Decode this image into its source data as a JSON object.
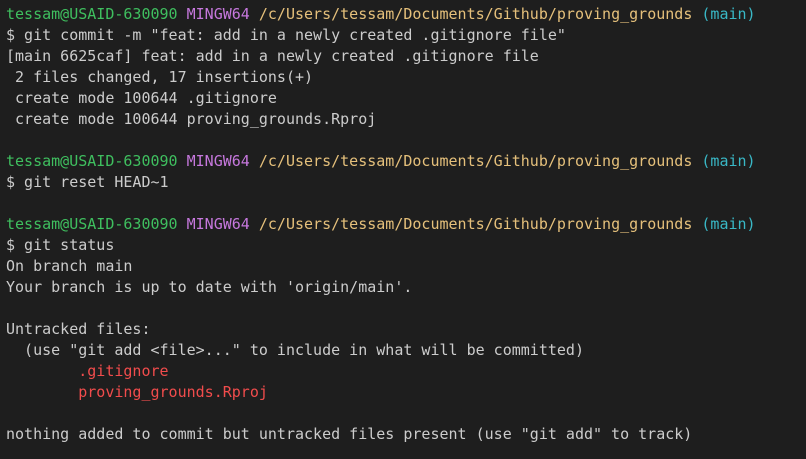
{
  "prompt": {
    "user_host": "tessam@USAID-630090",
    "system": "MINGW64",
    "path": "/c/Users/tessam/Documents/Github/proving_grounds",
    "branch": "(main)"
  },
  "colors": {
    "background": "#1e1e1e",
    "text": "#cccccc",
    "user_host": "#3fbf5f",
    "system": "#c678dd",
    "path": "#e5c07b",
    "branch": "#39b8c6",
    "untracked": "#f14c4c"
  },
  "lines": [
    {
      "type": "prompt"
    },
    {
      "type": "text",
      "text": "$ git commit -m \"feat: add in a newly created .gitignore file\""
    },
    {
      "type": "text",
      "text": "[main 6625caf] feat: add in a newly created .gitignore file"
    },
    {
      "type": "text",
      "text": " 2 files changed, 17 insertions(+)"
    },
    {
      "type": "text",
      "text": " create mode 100644 .gitignore"
    },
    {
      "type": "text",
      "text": " create mode 100644 proving_grounds.Rproj"
    },
    {
      "type": "blank"
    },
    {
      "type": "prompt"
    },
    {
      "type": "text",
      "text": "$ git reset HEAD~1"
    },
    {
      "type": "blank"
    },
    {
      "type": "prompt"
    },
    {
      "type": "text",
      "text": "$ git status"
    },
    {
      "type": "text",
      "text": "On branch main"
    },
    {
      "type": "text",
      "text": "Your branch is up to date with 'origin/main'."
    },
    {
      "type": "blank"
    },
    {
      "type": "text",
      "text": "Untracked files:"
    },
    {
      "type": "text",
      "text": "  (use \"git add <file>...\" to include in what will be committed)"
    },
    {
      "type": "untracked",
      "text": "        .gitignore"
    },
    {
      "type": "untracked",
      "text": "        proving_grounds.Rproj"
    },
    {
      "type": "blank"
    },
    {
      "type": "text",
      "text": "nothing added to commit but untracked files present (use \"git add\" to track)"
    }
  ]
}
